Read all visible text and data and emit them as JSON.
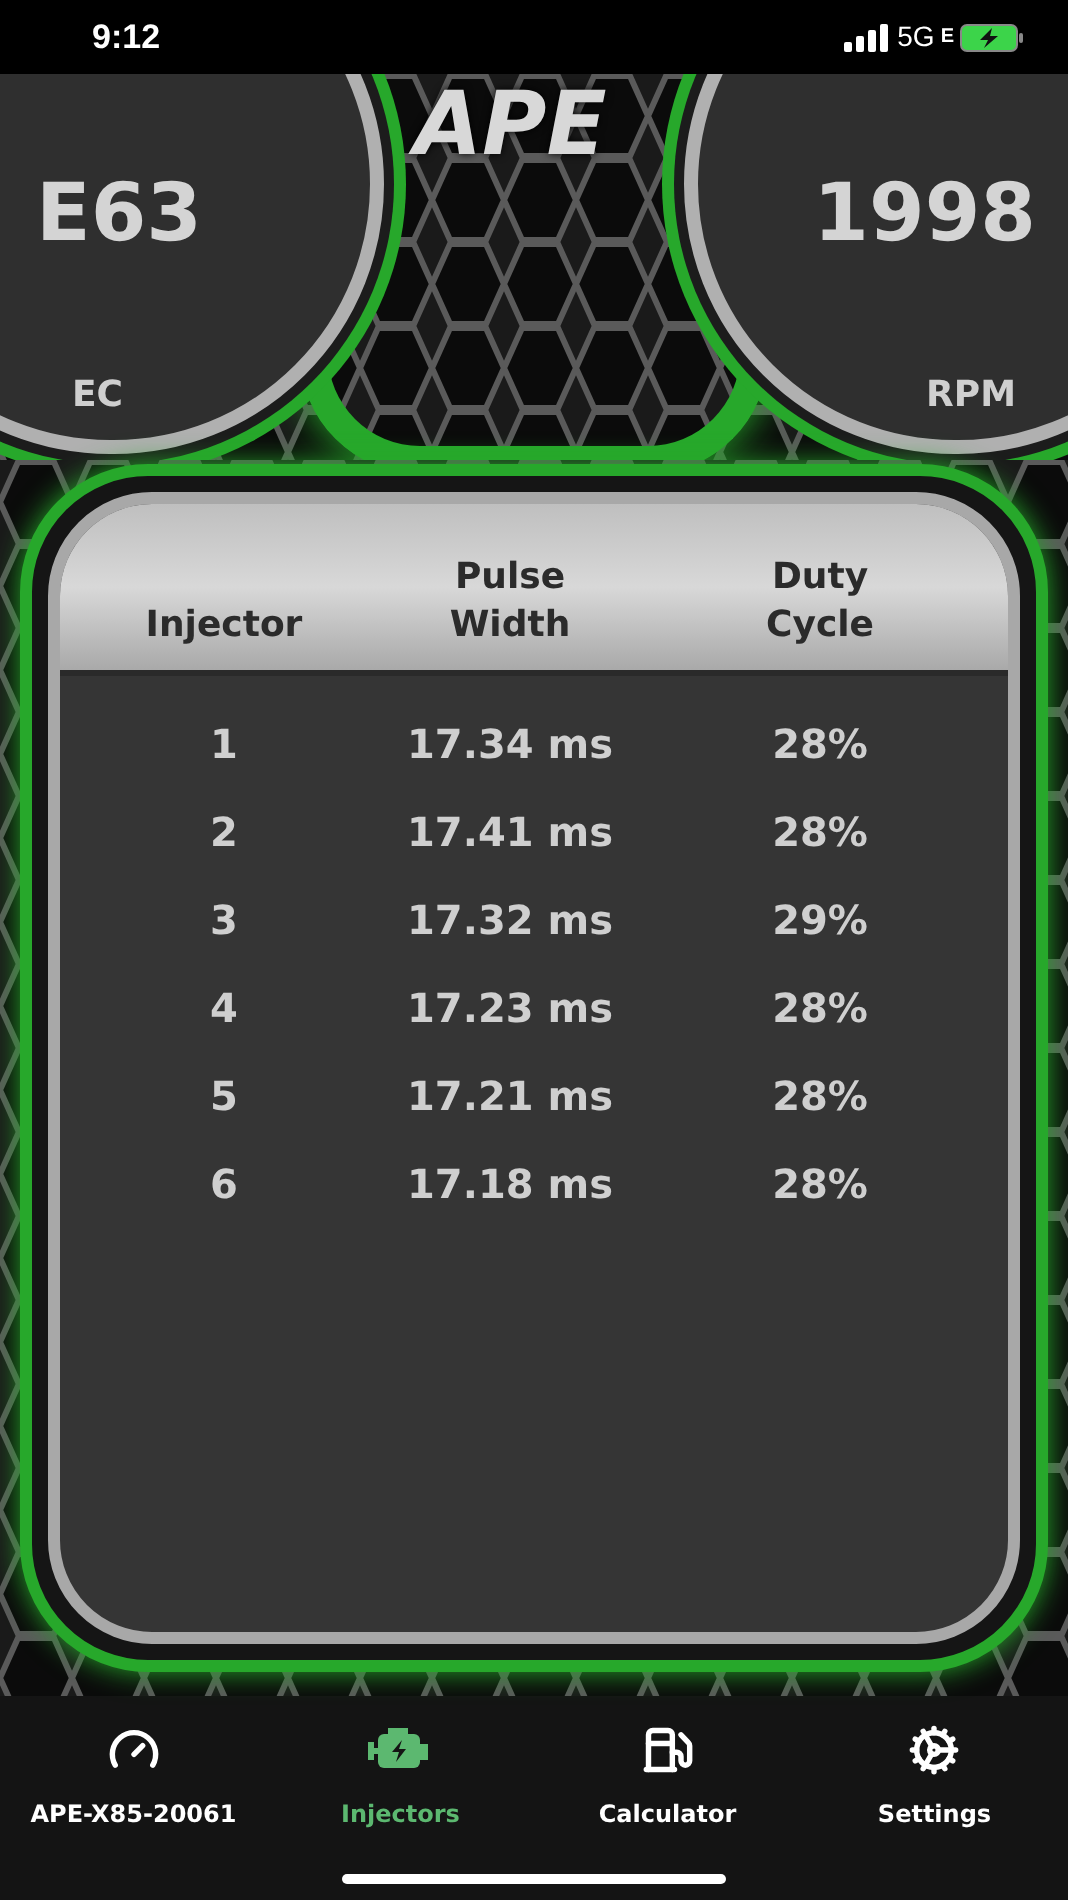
{
  "status_bar": {
    "time": "9:12",
    "network": "5G",
    "network_sub": "E"
  },
  "logo": "APE",
  "gauges": [
    {
      "value": "E63",
      "label": "EC",
      "kind": "left"
    },
    {
      "value": "1998",
      "label": "RPM",
      "kind": "right"
    }
  ],
  "table": {
    "columns": [
      "Injector",
      "Pulse Width",
      "Duty Cycle"
    ],
    "rows": [
      [
        "1",
        "17.34 ms",
        "28%"
      ],
      [
        "2",
        "17.41 ms",
        "28%"
      ],
      [
        "3",
        "17.32 ms",
        "29%"
      ],
      [
        "4",
        "17.23 ms",
        "28%"
      ],
      [
        "5",
        "17.21 ms",
        "28%"
      ],
      [
        "6",
        "17.18 ms",
        "28%"
      ]
    ]
  },
  "tab_bar": [
    {
      "label": "APE-X85-20061",
      "kind": "gauge",
      "selected": false
    },
    {
      "label": "Injectors",
      "kind": "engine",
      "selected": true
    },
    {
      "label": "Calculator",
      "kind": "fuel",
      "selected": false
    },
    {
      "label": "Settings",
      "kind": "gears",
      "selected": false
    }
  ]
}
